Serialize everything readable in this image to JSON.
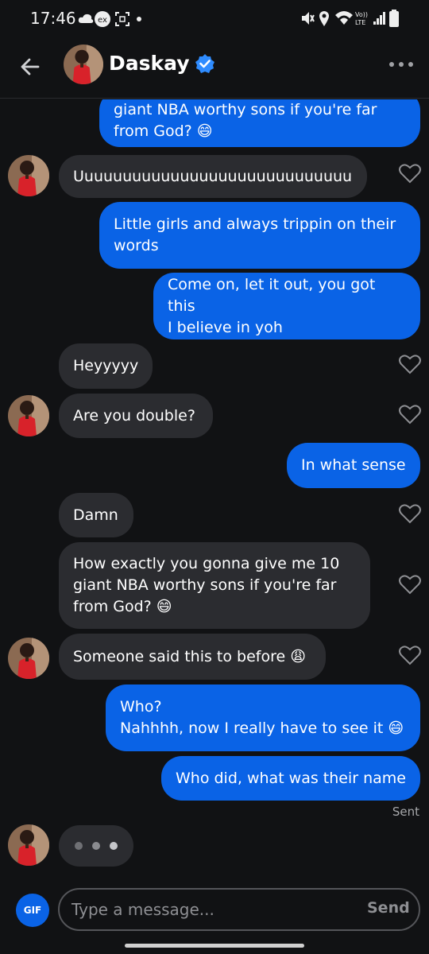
{
  "status_bar": {
    "time": "17:46"
  },
  "header": {
    "contact_name": "Daskay"
  },
  "messages": [
    {
      "dir": "out",
      "text": "giant NBA worthy sons if you're far\nfrom God? 😄"
    },
    {
      "dir": "in",
      "text": "Uuuuuuuuuuuuuuuuuuuuuuuuuuuuu"
    },
    {
      "dir": "out",
      "text": "Little girls and always trippin on their\nwords"
    },
    {
      "dir": "out",
      "text": "Come on, let it out, you got this\nI believe in yoh"
    },
    {
      "dir": "in",
      "text": "Heyyyyy"
    },
    {
      "dir": "in",
      "text": "Are you double?"
    },
    {
      "dir": "out",
      "text": "In what sense"
    },
    {
      "dir": "in",
      "text": "Damn"
    },
    {
      "dir": "in",
      "text": "How exactly you gonna give me 10\ngiant NBA worthy sons if you're far\nfrom God? 😄"
    },
    {
      "dir": "in",
      "text": "Someone said this to before 😩"
    },
    {
      "dir": "out",
      "text": "Who?\nNahhhh, now I really have to see it 😄"
    },
    {
      "dir": "out",
      "text": "Who did, what was their name"
    }
  ],
  "sent_label": "Sent",
  "composer": {
    "gif_label": "GIF",
    "placeholder": "Type a message...",
    "send_label": "Send"
  },
  "colors": {
    "outgoing_bubble": "#0a63e6",
    "incoming_bubble": "#2b2c30",
    "background": "#111214"
  }
}
